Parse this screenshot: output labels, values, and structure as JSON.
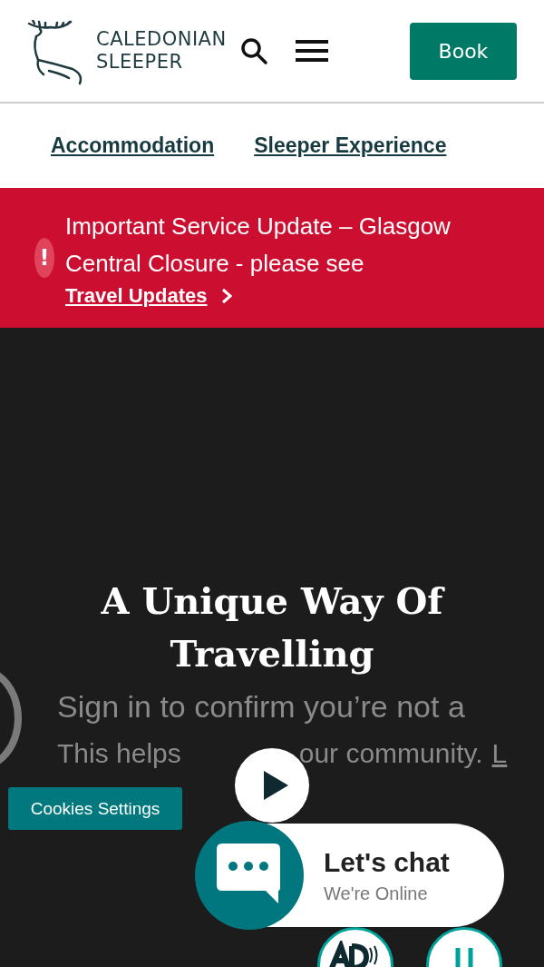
{
  "header": {
    "logo_line1": "CALEDONIAN",
    "logo_line2": "SLEEPER",
    "book_button": "Book"
  },
  "nav": [
    {
      "label": "Accommodation"
    },
    {
      "label": "Sleeper Experience"
    }
  ],
  "alert": {
    "icon": "!",
    "text": "Important Service Update – Glasgow Central Closure - please see",
    "link": "Travel Updates"
  },
  "hero": {
    "title": "A Unique Way Of Travelling",
    "overlay_line1": "Sign in to confirm you’re not a",
    "overlay_line2": "This helps",
    "overlay_line3": "our community.",
    "overlay_link": "L"
  },
  "cookies_button": "Cookies Settings",
  "chat": {
    "title": "Let's chat",
    "status": "We're Online"
  }
}
